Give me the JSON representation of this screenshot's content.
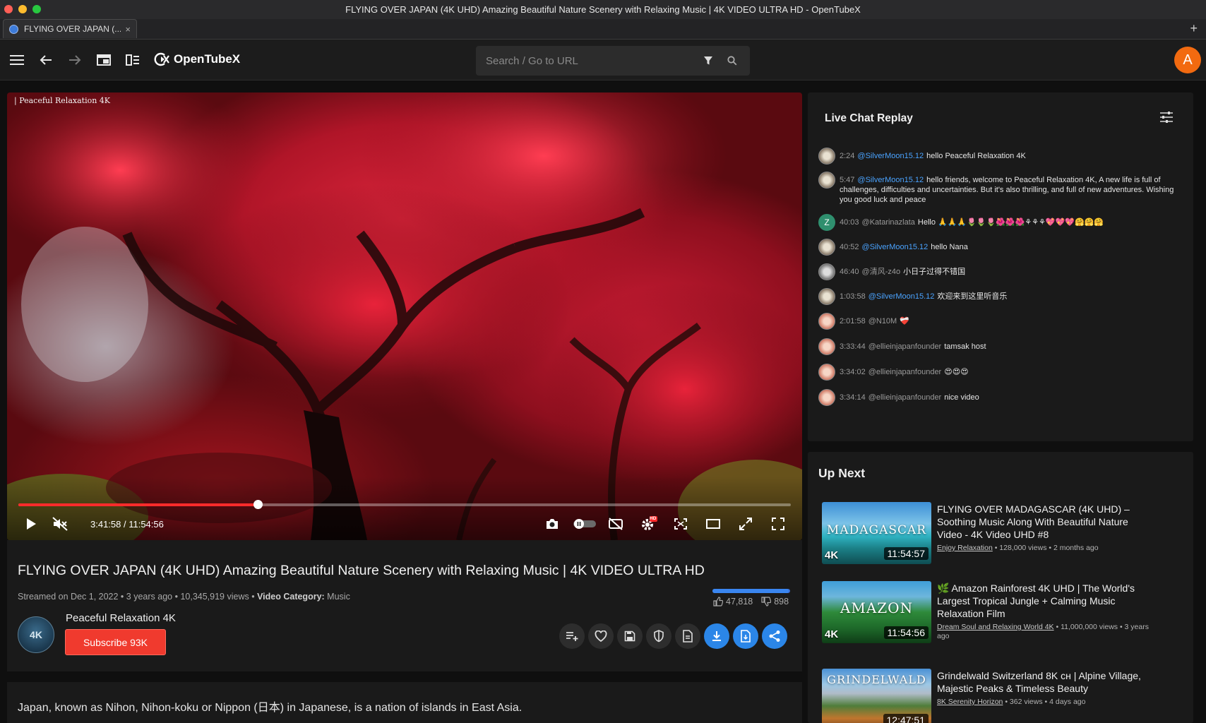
{
  "window": {
    "title": "FLYING OVER JAPAN (4K UHD) Amazing Beautiful Nature Scenery with Relaxing Music | 4K VIDEO ULTRA HD - OpenTubeX",
    "traffic_colors": [
      "#ff5f57",
      "#febc2e",
      "#28c840"
    ]
  },
  "tab": {
    "label": "FLYING OVER JAPAN (...",
    "close": "×",
    "new_tab": "+"
  },
  "toolbar": {
    "app_name": "OpenTubeX",
    "search_placeholder": "Search / Go to URL",
    "account_initial": "A",
    "account_color": "#f26a10"
  },
  "player": {
    "watermark": "| Peaceful Relaxation 4K",
    "current_time": "3:41:58",
    "duration": "11:54:56",
    "time_display": "3:41:58 / 11:54:56",
    "progress_fraction": 0.31,
    "quality_badge": "HD",
    "accent_color": "#ff2b2b"
  },
  "video": {
    "title": "FLYING OVER JAPAN (4K UHD) Amazing Beautiful Nature Scenery with Relaxing Music | 4K VIDEO ULTRA HD",
    "streamed": "Streamed on Dec 1, 2022",
    "age": "3 years ago",
    "views": "10,345,919 views",
    "category_label": "Video Category:",
    "category": "Music",
    "likes": "47,818",
    "dislikes": "898",
    "like_ratio": 0.98,
    "channel": "Peaceful Relaxation 4K",
    "subscribe_label": "Subscribe 93K",
    "description": "Japan, known as Nihon, Nihon-koku or Nippon (日本) in Japanese, is a nation of islands in East Asia."
  },
  "chat": {
    "title": "Live Chat Replay",
    "messages": [
      {
        "time": "2:24",
        "user": "@SilverMoon15.12",
        "mod": true,
        "text": "hello Peaceful Relaxation 4K"
      },
      {
        "time": "5:47",
        "user": "@SilverMoon15.12",
        "mod": true,
        "text": "hello friends, welcome to Peaceful Relaxation 4K, A new life is full of challenges, difficulties and uncertainties. But it's also thrilling, and full of new adventures. Wishing you good luck and peace"
      },
      {
        "time": "40:03",
        "user": "@Katarinazlata",
        "mod": false,
        "avatar_letter": "Z",
        "text": "Hello 🙏🙏🙏🌷🌷🌷🌺🌺🌺⚘⚘⚘💖💖💖🤗🤗🤗"
      },
      {
        "time": "40:52",
        "user": "@SilverMoon15.12",
        "mod": true,
        "text": "hello Nana"
      },
      {
        "time": "46:40",
        "user": "@清风-z4o",
        "mod": false,
        "text": "小日子过得不错国"
      },
      {
        "time": "1:03:58",
        "user": "@SilverMoon15.12",
        "mod": true,
        "text": "欢迎来到这里听音乐"
      },
      {
        "time": "2:01:58",
        "user": "@N10M",
        "mod": false,
        "text": "❤️‍🩹"
      },
      {
        "time": "3:33:44",
        "user": "@ellieinjapanfounder",
        "mod": false,
        "text": "tamsak host"
      },
      {
        "time": "3:34:02",
        "user": "@ellieinjapanfounder",
        "mod": false,
        "text": "😍😍😍"
      },
      {
        "time": "3:34:14",
        "user": "@ellieinjapanfounder",
        "mod": false,
        "text": "nice video"
      }
    ]
  },
  "up_next": {
    "title": "Up Next",
    "items": [
      {
        "thumb_text": "MADAGASCAR",
        "thumb_badge": "4K",
        "duration": "11:54:57",
        "title": "FLYING OVER MADAGASCAR (4K UHD) – Soothing Music Along With Beautiful Nature Video - 4K Video UHD #8",
        "channel": "Enjoy Relaxation",
        "meta": "• 128,000 views • 2 months ago"
      },
      {
        "thumb_text": "AMAZON",
        "thumb_badge": "4K",
        "duration": "11:54:56",
        "title": "🌿 Amazon Rainforest 4K UHD | The World's Largest Tropical Jungle + Calming Music Relaxation Film",
        "channel": "Dream Soul and Relaxing World 4K",
        "meta": "• 11,000,000 views • 3 years ago"
      },
      {
        "thumb_text": "GRINDELWALD",
        "thumb_badge": "",
        "duration": "12:47:51",
        "title": "Grindelwald Switzerland 8K ᴄʜ | Alpine Village, Majestic Peaks & Timeless Beauty",
        "channel": "8K Serenity Horizon",
        "meta": "• 362 views • 4 days ago"
      }
    ]
  }
}
